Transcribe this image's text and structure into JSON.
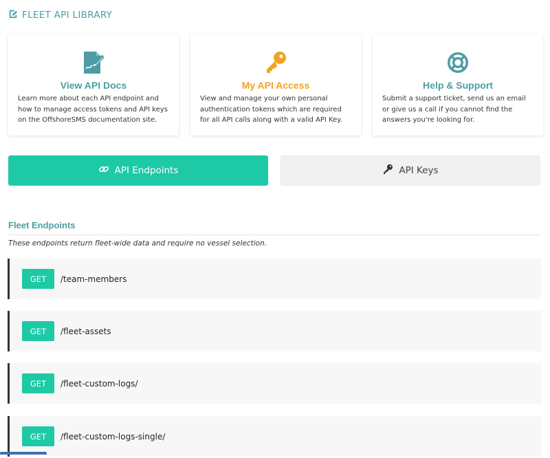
{
  "header": {
    "title": "FLEET API LIBRARY",
    "icon": "edit-doc-icon"
  },
  "cards": [
    {
      "title": "View API Docs",
      "description": "Learn more about each API endpoint and how to manage access tokens and API keys on the OffshoreSMS documentation site.",
      "icon": "document-signature-icon",
      "color": "#4d9da3"
    },
    {
      "title": "My API Access",
      "description": "View and manage your own personal authentication tokens which are required for all API calls along with a valid API Key.",
      "icon": "key-icon",
      "color": "#f0a320"
    },
    {
      "title": "Help & Support",
      "description": "Submit a support ticket, send us an email or give us a call if you cannot find the answers you're looking for.",
      "icon": "lifebuoy-icon",
      "color": "#4d9da3"
    }
  ],
  "tabs": [
    {
      "label": "API Endpoints",
      "icon": "link-icon",
      "active": true
    },
    {
      "label": "API Keys",
      "icon": "key-icon",
      "active": false
    }
  ],
  "section": {
    "title": "Fleet Endpoints",
    "description": "These endpoints return fleet-wide data and require no vessel selection."
  },
  "endpoints": [
    {
      "method": "GET",
      "path": "/team-members"
    },
    {
      "method": "GET",
      "path": "/fleet-assets"
    },
    {
      "method": "GET",
      "path": "/fleet-custom-logs/"
    },
    {
      "method": "GET",
      "path": "/fleet-custom-logs-single/"
    }
  ],
  "colors": {
    "accent": "#1ec9a6",
    "teal_text": "#4d9da3",
    "orange": "#f0a320"
  }
}
